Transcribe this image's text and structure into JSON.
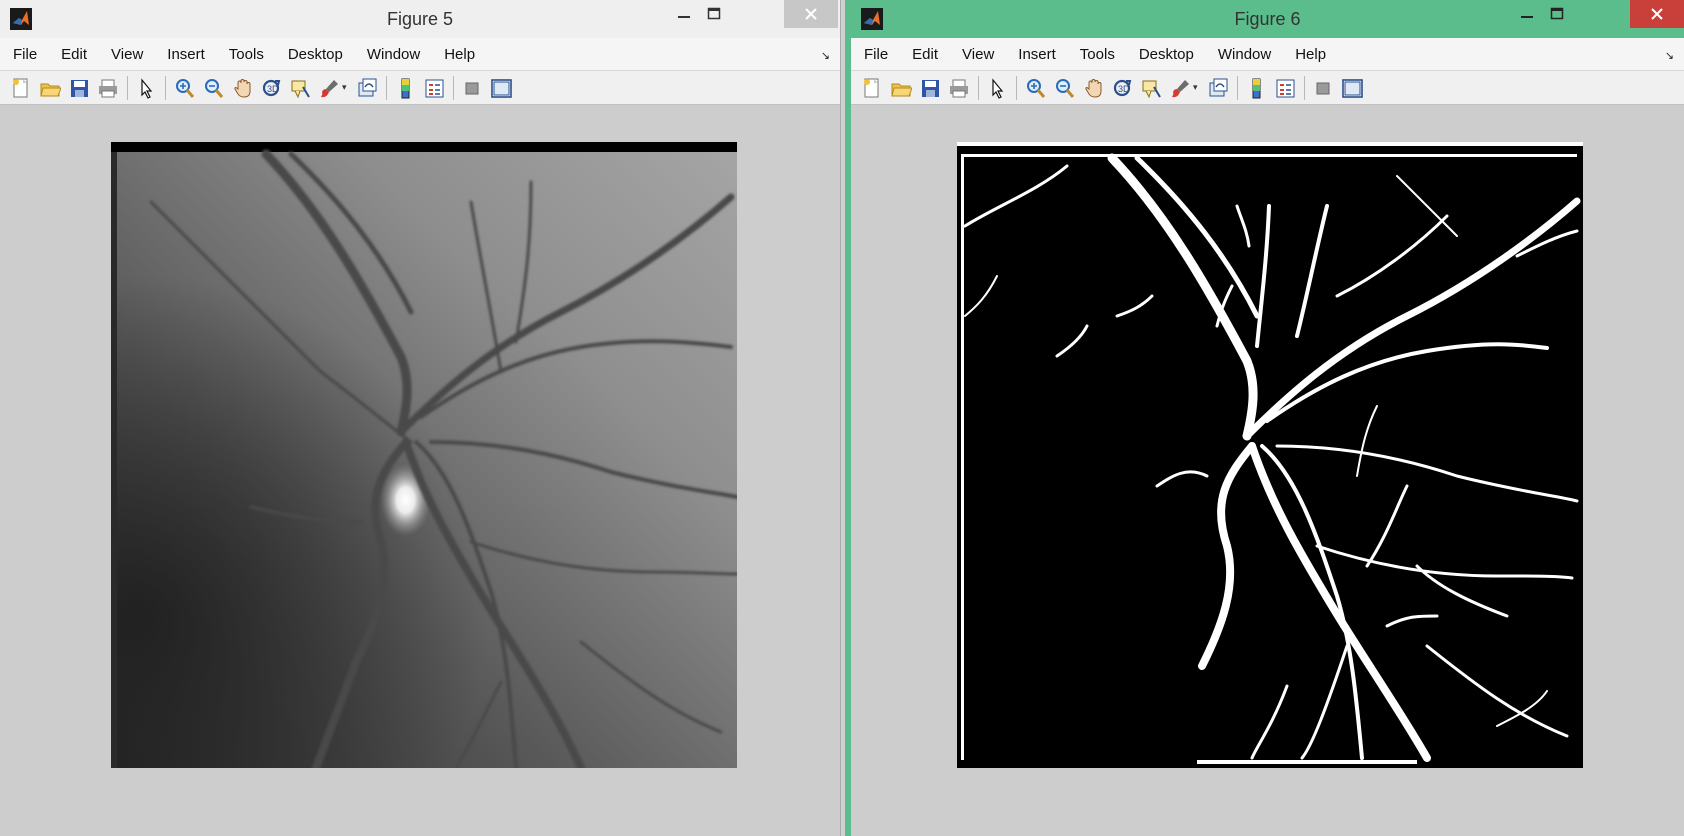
{
  "figures": [
    {
      "title": "Figure 5",
      "menu": [
        "File",
        "Edit",
        "View",
        "Insert",
        "Tools",
        "Desktop",
        "Window",
        "Help"
      ]
    },
    {
      "title": "Figure 6",
      "menu": [
        "File",
        "Edit",
        "View",
        "Insert",
        "Tools",
        "Desktop",
        "Window",
        "Help"
      ]
    }
  ],
  "toolbar_icons": [
    "new-figure-icon",
    "open-file-icon",
    "save-figure-icon",
    "print-figure-icon",
    "edit-plot-icon",
    "zoom-in-icon",
    "zoom-out-icon",
    "pan-icon",
    "rotate-3d-icon",
    "data-cursor-icon",
    "brush-icon",
    "link-plot-icon",
    "insert-colorbar-icon",
    "insert-legend-icon",
    "hide-plot-tools-icon",
    "show-plot-tools-icon"
  ],
  "colors": {
    "active_titlebar": "#5bbd8c",
    "inactive_titlebar": "#efefef",
    "close_active": "#c9403a",
    "figure_background": "#cdcdcd"
  }
}
